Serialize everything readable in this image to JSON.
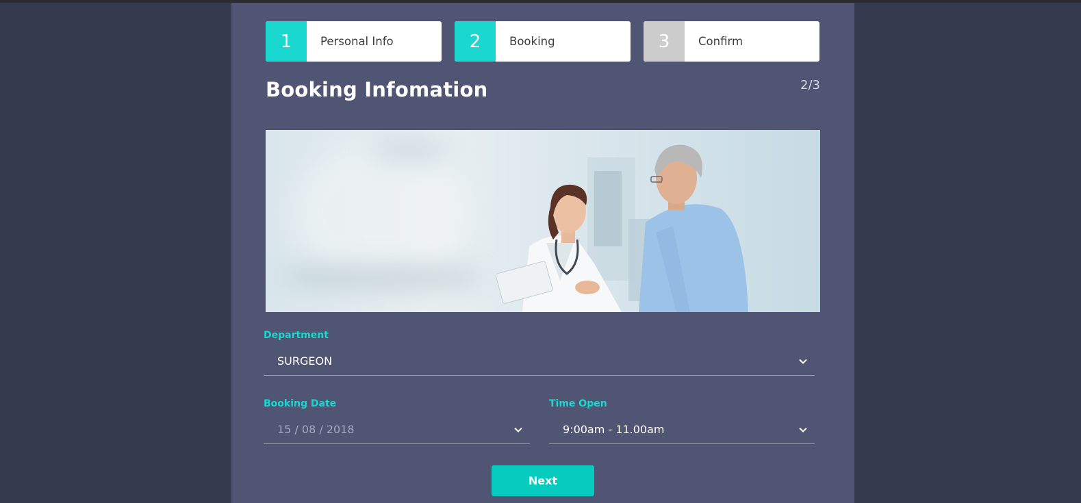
{
  "steps": [
    {
      "number": "1",
      "label": "Personal Info",
      "state": "complete",
      "color": "#1ad8cf"
    },
    {
      "number": "2",
      "label": "Booking",
      "state": "active",
      "color": "#1ad8cf"
    },
    {
      "number": "3",
      "label": "Confirm",
      "state": "pending",
      "color": "#cccccc"
    }
  ],
  "header": {
    "title": "Booking Infomation",
    "page_count": "2/3"
  },
  "hero": {
    "icon": "doctor-patient-photo"
  },
  "form": {
    "department": {
      "label": "Department",
      "value": "SURGEON"
    },
    "booking_date": {
      "label": "Booking Date",
      "value": "15 / 08 / 2018"
    },
    "time_open": {
      "label": "Time Open",
      "value": "9:00am - 11.00am"
    },
    "next_label": "Next"
  },
  "colors": {
    "accent": "#1ad8cf",
    "button": "#06cbbe",
    "panel": "#505574",
    "background": "#363a4f"
  }
}
